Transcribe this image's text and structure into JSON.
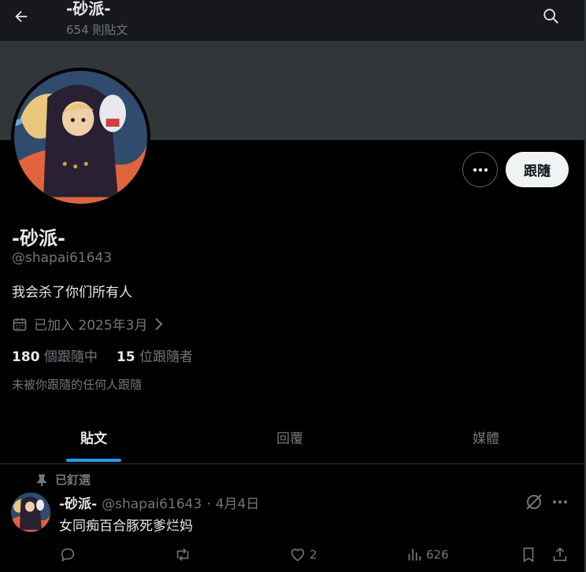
{
  "header": {
    "title": "-砂派-",
    "post_count": "654 則貼文"
  },
  "profile": {
    "name": "-砂派-",
    "handle": "@shapai61643",
    "bio": "我会杀了你们所有人",
    "joined": "已加入 2025年3月",
    "following_count": "180",
    "following_label": "個跟隨中",
    "followers_count": "15",
    "followers_label": "位跟隨者",
    "not_followed_text": "未被你跟隨的任何人跟隨"
  },
  "actions": {
    "follow_label": "跟隨"
  },
  "tabs": [
    {
      "label": "貼文",
      "active": true
    },
    {
      "label": "回覆",
      "active": false
    },
    {
      "label": "媒體",
      "active": false
    }
  ],
  "post": {
    "pinned_label": "已釘選",
    "author": "-砂派-",
    "handle": "@shapai61643",
    "separator": "·",
    "date": "4月4日",
    "text": "女同痴百合豚死爹烂妈",
    "replies": "",
    "reposts": "",
    "likes": "2",
    "views": "626"
  },
  "colors": {
    "background": "#000000",
    "banner": "#333639",
    "accent": "#1d9bf0",
    "text": "#e7e9ea",
    "muted": "#71767b"
  },
  "icons": {
    "back": "arrow-left-icon",
    "search": "search-icon",
    "more": "more-horizontal-icon",
    "calendar": "calendar-icon",
    "chevron": "chevron-right-icon",
    "pin": "pin-icon",
    "grok": "grok-icon",
    "reply": "reply-icon",
    "repost": "repost-icon",
    "like": "heart-icon",
    "views": "views-icon",
    "bookmark": "bookmark-icon",
    "share": "share-icon"
  }
}
